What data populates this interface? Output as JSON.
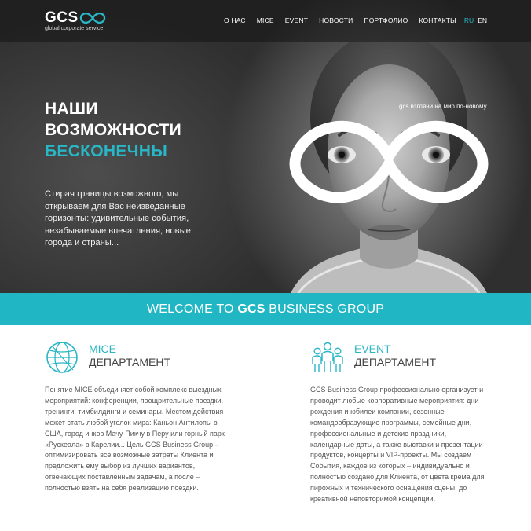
{
  "header": {
    "logo_text": "GCS",
    "logo_subtitle": "global corporate service",
    "nav": [
      "О НАС",
      "MICE",
      "EVENT",
      "НОВОСТИ",
      "ПОРТФОЛИО",
      "КОНТАКТЫ"
    ],
    "lang_active": "RU",
    "lang_other": "EN"
  },
  "hero": {
    "title_line1": "НАШИ",
    "title_line2": "ВОЗМОЖНОСТИ",
    "title_line3": "БЕСКОНЕЧНЫ",
    "tagline": "gcs взгляни на мир по-новому",
    "description": "Стирая границы возможного, мы открываем для Вас неизведанные горизонты: удивительные события, незабываемые впечатления, новые города и страны..."
  },
  "banner": {
    "prefix": "WELCOME TO ",
    "brand": "GCS",
    "suffix": " BUSINESS GROUP"
  },
  "departments": [
    {
      "name": "MICE",
      "subtitle": "ДЕПАРТАМЕНТ",
      "icon": "globe-icon",
      "text": "Понятие MICE объединяет собой комплекс выездных мероприятий: конференции, поощрительные поездки, тренинги, тимбилдинги и семинары. Местом действия может стать любой уголок мира: Каньон Антилопы в США, город инков Мачу-Пикчу в Перу или горный парк «Рускеала» в Карелии... Цель GCS Business Group – оптимизировать все возможные затраты Клиента и предложить ему выбор из лучших вариантов, отвечающих поставленным задачам, а после – полностью взять на себя реализацию поездки."
    },
    {
      "name": "EVENT",
      "subtitle": "ДЕПАРТАМЕНТ",
      "icon": "people-group-icon",
      "text": "GCS Business Group профессионально организует и проводит любые корпоративные мероприятия: дни рождения и юбилеи компании, сезонные командообразующие программы, семейные дни, профессиональные и детские праздники, календарные даты, а также выставки и презентации продуктов, концерты и VIP-проекты. Мы создаем События, каждое из которых – индивидуально и полностью создано для Клиента, от цвета крема для пирожных и технического оснащения сцены, до креативной неповторимой концепции."
    }
  ],
  "colors": {
    "accent": "#29b6c5",
    "banner": "#20b6c4",
    "hero_dark": "#2a2a2a"
  }
}
